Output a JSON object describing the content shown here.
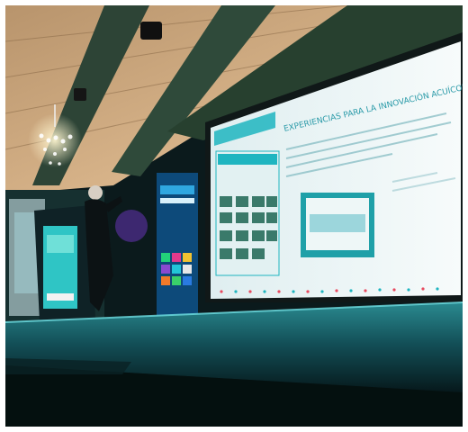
{
  "photo": {
    "subject": "",
    "colors": {
      "ceiling": "#c9a27a",
      "beam": "#2f4a3a",
      "stage": "#0e3a40",
      "screen": "#eef4f5",
      "accent": "#1fb5c0"
    }
  },
  "slide": {
    "heading": "EXPERIENCIAS PARA LA INNOVACIÓN ACUÍCOLA"
  }
}
